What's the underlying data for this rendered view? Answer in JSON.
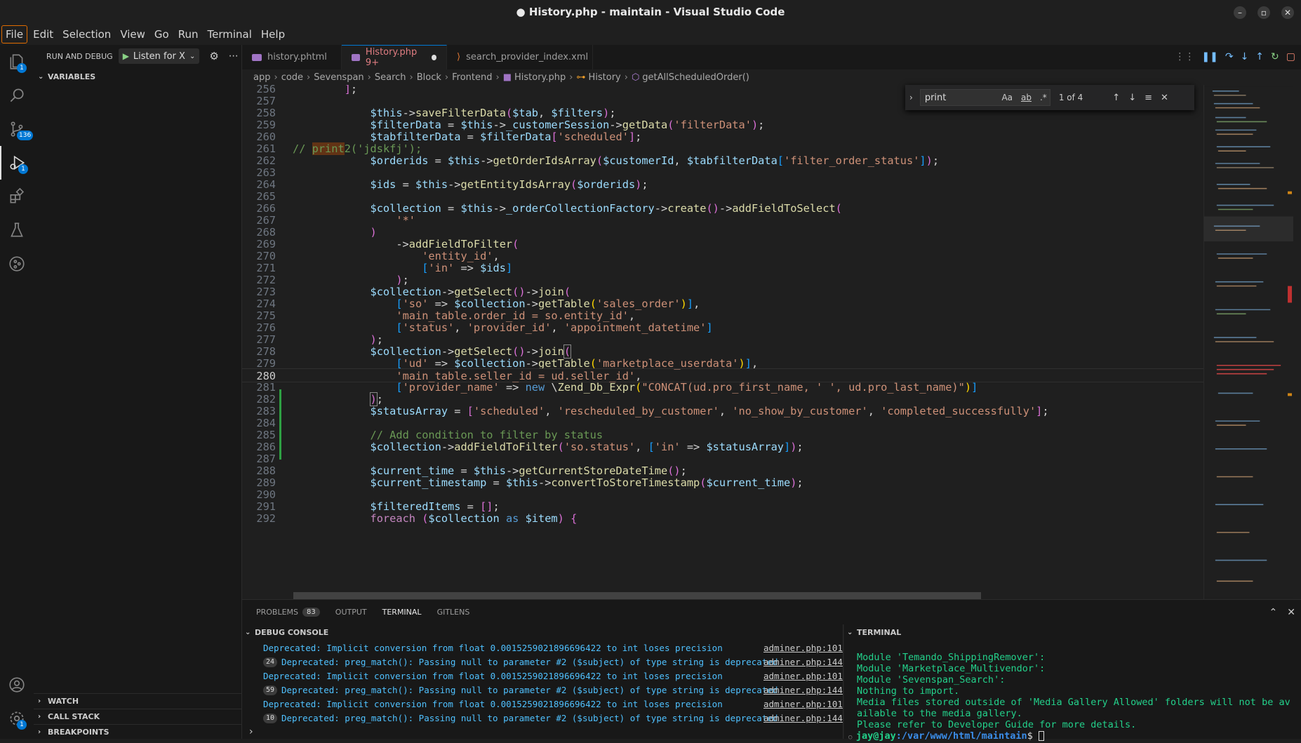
{
  "window": {
    "title": "● History.php - maintain - Visual Studio Code"
  },
  "menu": [
    "File",
    "Edit",
    "Selection",
    "View",
    "Go",
    "Run",
    "Terminal",
    "Help"
  ],
  "activity_badges": {
    "explorer": "1",
    "scm": "136",
    "debug": "1",
    "settings": "1"
  },
  "sidebar": {
    "title": "RUN AND DEBUG",
    "launch": "Listen for X",
    "variables": "VARIABLES",
    "watch": "WATCH",
    "call_stack": "CALL STACK",
    "breakpoints": "BREAKPOINTS"
  },
  "tabs": [
    {
      "label": "history.phtml",
      "color": "#a074c4"
    },
    {
      "label": "History.php 9+",
      "color": "#a074c4",
      "active": true
    },
    {
      "label": "search_provider_index.xml",
      "color": "#e37933"
    }
  ],
  "breadcrumb": [
    "app",
    "code",
    "Sevenspan",
    "Search",
    "Block",
    "Frontend",
    "History.php",
    "History",
    "getAllScheduledOrder()"
  ],
  "find": {
    "query": "print",
    "result": "1 of 4",
    "aa": "Aa",
    "ab": "ab",
    "re": ".*"
  },
  "lines": [
    "256",
    "257",
    "258",
    "259",
    "260",
    "261",
    "262",
    "263",
    "264",
    "265",
    "266",
    "267",
    "268",
    "269",
    "270",
    "271",
    "272",
    "273",
    "274",
    "275",
    "276",
    "277",
    "278",
    "279",
    "280",
    "281",
    "282",
    "283",
    "284",
    "285",
    "286",
    "287",
    "288",
    "289",
    "290",
    "291",
    "292"
  ],
  "panel": {
    "tabs": [
      "PROBLEMS",
      "OUTPUT",
      "TERMINAL",
      "GITLENS"
    ],
    "problems_count": "83",
    "debug_title": "DEBUG CONSOLE",
    "terminal_title": "TERMINAL"
  },
  "debug_console": [
    {
      "msg": "Deprecated: Implicit conversion from float 0.0015259021896696422 to int loses precision",
      "src": "adminer.php:101",
      "count": ""
    },
    {
      "msg": "Deprecated: preg_match(): Passing null to parameter #2 ($subject) of type string is deprecated",
      "src": "adminer.php:144",
      "count": "24"
    },
    {
      "msg": "Deprecated: Implicit conversion from float 0.0015259021896696422 to int loses precision",
      "src": "adminer.php:101",
      "count": ""
    },
    {
      "msg": "Deprecated: preg_match(): Passing null to parameter #2 ($subject) of type string is deprecated",
      "src": "adminer.php:144",
      "count": "59"
    },
    {
      "msg": "Deprecated: Implicit conversion from float 0.0015259021896696422 to int loses precision",
      "src": "adminer.php:101",
      "count": ""
    },
    {
      "msg": "Deprecated: preg_match(): Passing null to parameter #2 ($subject) of type string is deprecated",
      "src": "adminer.php:144",
      "count": "10"
    }
  ],
  "terminal": [
    "Module 'Temando_ShippingRemover':",
    "Module 'Marketplace_Multivendor':",
    "Module 'Sevenspan_Search':",
    "Nothing to import.",
    "Media files stored outside of 'Media Gallery Allowed' folders will not be av",
    "ailable to the media gallery.",
    "Please refer to Developer Guide for more details."
  ],
  "prompt": {
    "user": "jay@jay",
    "path": ":/var/www/html/maintain",
    "sign": "$ "
  }
}
